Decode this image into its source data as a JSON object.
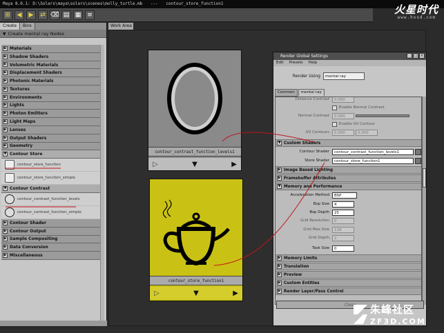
{
  "titlebar": {
    "app": "Maya 8.0.1",
    "path": "D:\\Solars\\maya\\solars\\scenes\\molly_turtle.mb",
    "sep": "---",
    "node": "contour_store_function1"
  },
  "watermark_top": {
    "cn": "火星时代",
    "url": "www.hxsd.com"
  },
  "watermark_bottom": {
    "cn": "朱峰社区",
    "en": "ZF3D.COM"
  },
  "left": {
    "tabs": [
      "Create",
      "Bins"
    ],
    "header": "Create mental ray Nodes",
    "categories": [
      {
        "label": "Materials"
      },
      {
        "label": "Shadow Shaders"
      },
      {
        "label": "Volumetric Materials"
      },
      {
        "label": "Displacement Shaders"
      },
      {
        "label": "Photonic Materials"
      },
      {
        "label": "Textures"
      },
      {
        "label": "Environments"
      },
      {
        "label": "Lights"
      },
      {
        "label": "Photon Emitters"
      },
      {
        "label": "Light Maps"
      },
      {
        "label": "Lenses"
      },
      {
        "label": "Output Shaders"
      },
      {
        "label": "Geometry"
      }
    ],
    "contour_store": {
      "label": "Contour Store",
      "nodes": [
        "contour_store_function",
        "contour_store_function_simple"
      ]
    },
    "contour_contrast": {
      "label": "Contour Contrast",
      "nodes": [
        "contour_contrast_function_levels",
        "contour_contrast_function_simple"
      ]
    },
    "categories_bottom": [
      {
        "label": "Contour Shader"
      },
      {
        "label": "Contour Output"
      },
      {
        "label": "Sample Compositing"
      },
      {
        "label": "Data Conversion"
      },
      {
        "label": "Miscellaneous"
      }
    ]
  },
  "workarea": {
    "tab": "Work Area",
    "swatch1": {
      "label": "contour_contrast_function_levels1"
    },
    "swatch2": {
      "label": "contour_store_function1"
    }
  },
  "rgs": {
    "title": "Render Global Settings",
    "menu": [
      "Edit",
      "Presets",
      "Help"
    ],
    "render_using_label": "Render Using",
    "render_using_value": "mental ray",
    "tabs": [
      "Common",
      "mental ray"
    ],
    "rows_top": {
      "distance_contrast_label": "Distance Contrast",
      "distance_contrast_value": "0.000",
      "enable_normal_contrast": "Enable Normal Contrast",
      "normal_contrast_label": "Normal Contrast",
      "normal_contrast_value": "0.000",
      "enable_uv_contour": "Enable UV Contour",
      "uv_contour_label": "UV Contours",
      "uv_contour_v1": "0.000",
      "uv_contour_v2": "0.000"
    },
    "custom_shaders": {
      "label": "Custom Shaders",
      "contour_shader_label": "Contour Shader",
      "contour_shader_value": "contour_contrast_function_levels1",
      "store_shader_label": "Store Shader",
      "store_shader_value": "contour_store_function1"
    },
    "section_ibl": "Image Based Lighting",
    "section_fb": "Framebuffer Attributes",
    "memory": {
      "label": "Memory and Performance",
      "accel_label": "Acceleration Method",
      "accel_value": "BSP",
      "bsp_size_label": "Bsp Size",
      "bsp_size_value": "4",
      "bsp_depth_label": "Bsp Depth",
      "bsp_depth_value": "25",
      "grid_res_label": "Grid Resolution",
      "grid_res_value": "0",
      "grid_max_label": "Grid Max Size",
      "grid_max_value": "128",
      "grid_depth_label": "Grid Depth",
      "grid_depth_value": "2",
      "task_size_label": "Task Size",
      "task_size_value": "0"
    },
    "sections_bottom": [
      "Memory Limits",
      "Translation",
      "Preview",
      "Custom Entities",
      "Render Layer/Pass Control"
    ],
    "close": "Close"
  },
  "colors": {
    "accent_red": "#c0141a",
    "swatch_yellow": "#c9c214",
    "swatch_gray": "#8a8a8a"
  }
}
